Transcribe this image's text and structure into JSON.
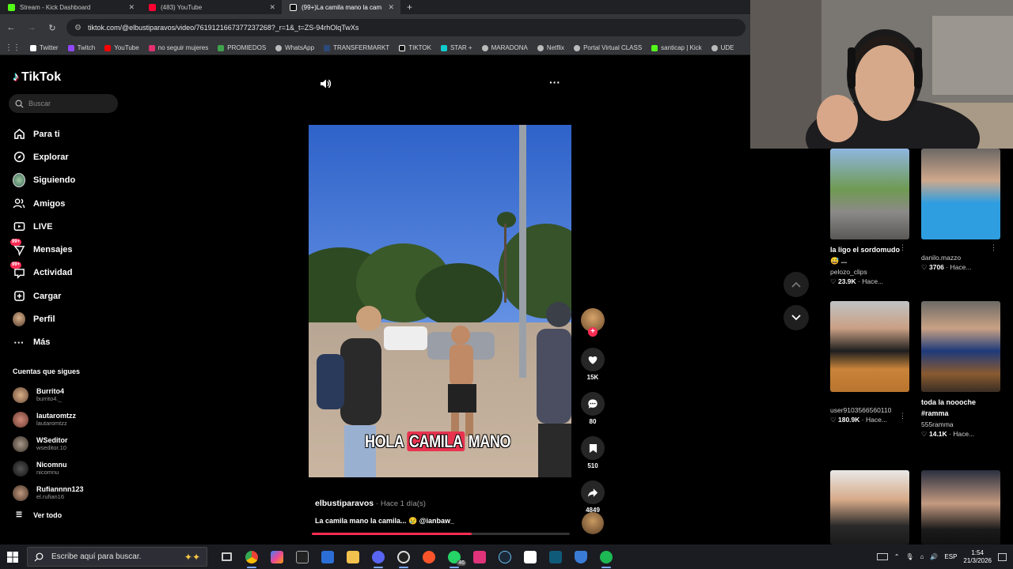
{
  "browser": {
    "tabs": [
      {
        "title": "Stream - Kick Dashboard",
        "color": "#53fc18"
      },
      {
        "title": "(483) YouTube",
        "color": "#ff0033"
      },
      {
        "title": "(99+)La camila mano la cam",
        "color": "#ffffff"
      }
    ],
    "new_tab": "+",
    "url": "tiktok.com/@elbustiparavos/video/7619121667377237268?_r=1&_t=ZS-94rhOlqTwXs",
    "bookmarks": [
      {
        "label": "Twitter",
        "color": "#ffffff"
      },
      {
        "label": "Twitch",
        "color": "#9146ff"
      },
      {
        "label": "YouTube",
        "color": "#ff0000"
      },
      {
        "label": "no seguir mujeres",
        "color": "#e1306c"
      },
      {
        "label": "PROMIEDOS",
        "color": "#3fa34d"
      },
      {
        "label": "WhatsApp",
        "color": "#bbbbbb"
      },
      {
        "label": "TRANSFERMARKT",
        "color": "#1a3151"
      },
      {
        "label": "TIKTOK",
        "color": "#ffffff"
      },
      {
        "label": "STAR +",
        "color": "#1cc"
      },
      {
        "label": "MARADONA",
        "color": "#bbbbbb"
      },
      {
        "label": "Netflix",
        "color": "#bbbbbb"
      },
      {
        "label": "Portal Virtual CLASS",
        "color": "#bbbbbb"
      },
      {
        "label": "santicap | Kick",
        "color": "#53fc18"
      },
      {
        "label": "UDE",
        "color": "#bbbbbb"
      }
    ]
  },
  "tiktok": {
    "logo": "TikTok",
    "search_placeholder": "Buscar",
    "nav": [
      {
        "label": "Para ti",
        "icon": "home-icon"
      },
      {
        "label": "Explorar",
        "icon": "compass-icon"
      },
      {
        "label": "Siguiendo",
        "icon": "following-avatar"
      },
      {
        "label": "Amigos",
        "icon": "friends-icon"
      },
      {
        "label": "LIVE",
        "icon": "live-icon"
      },
      {
        "label": "Mensajes",
        "icon": "messages-icon",
        "badge": "99+"
      },
      {
        "label": "Actividad",
        "icon": "activity-icon",
        "badge": "99+"
      },
      {
        "label": "Cargar",
        "icon": "upload-icon"
      },
      {
        "label": "Perfil",
        "icon": "profile-avatar"
      },
      {
        "label": "Más",
        "icon": "more-icon"
      }
    ],
    "following_title": "Cuentas que sigues",
    "following": [
      {
        "name": "Burrito4",
        "handle": "burrito4._",
        "color": "#c79a72"
      },
      {
        "name": "lautaromtzz",
        "handle": "lautaromtzz",
        "color": "#b77b6a"
      },
      {
        "name": "WSeditor",
        "handle": "wseditor.10",
        "color": "#8a7a6a"
      },
      {
        "name": "Nicomnu",
        "handle": "nicomnu",
        "color": "#222222"
      },
      {
        "name": "Rufiannnn123",
        "handle": "el.rufian16",
        "color": "#9a8070"
      }
    ],
    "see_all": "Ver todo",
    "video": {
      "overlay_text_1": "HOLA",
      "overlay_text_2": "CAMILA",
      "overlay_text_3": "MANO",
      "author": "elbustiparavos",
      "time": "· Hace 1 día(s)",
      "description": "La camila mano la camila... 😢 @ianbaw_",
      "progress": 0.62
    },
    "actions": {
      "likes": "15K",
      "comments": "80",
      "saves": "510",
      "shares": "4849"
    },
    "recommendations": [
      {
        "title": "la ligo el sordomudo😅 ...",
        "user": "pelozo_clips",
        "likes": "23.9K",
        "time": "Hace..."
      },
      {
        "title": "",
        "user": "danilo.mazzo",
        "likes": "3706",
        "time": "Hace..."
      },
      {
        "title": "",
        "user": "user9103566560110",
        "likes": "180.9K",
        "time": "Hace..."
      },
      {
        "title": "toda la noooche #ramma",
        "user": "555ramma",
        "likes": "14.1K",
        "time": "Hace..."
      }
    ]
  },
  "taskbar": {
    "search_placeholder": "Escribe aquí para buscar.",
    "whatsapp_badge": "46",
    "lang": "ESP",
    "time": "1:54",
    "date": "21/3/2026"
  }
}
